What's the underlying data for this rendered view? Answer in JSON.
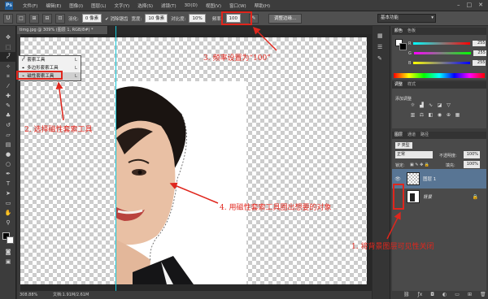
{
  "menu": [
    "文件(F)",
    "编辑(E)",
    "图像(I)",
    "图层(L)",
    "文字(Y)",
    "选择(S)",
    "滤镜(T)",
    "3D(D)",
    "视图(V)",
    "窗口(W)",
    "帮助(H)"
  ],
  "app_logo": "Ps",
  "options": {
    "feather_label": "羽化:",
    "feather_value": "0 像素",
    "antialias_label": "消除锯齿",
    "width_label": "宽度:",
    "width_value": "10 像素",
    "contrast_label": "对比度:",
    "contrast_value": "10%",
    "frequency_label": "频率:",
    "frequency_value": "100",
    "refine_button": "调整边缘...",
    "workspace": "基本功能"
  },
  "document": {
    "tab": "timg.jpg @ 309% (图层 1, RGB/8#) *",
    "zoom": "308.88%",
    "doc_info": "文档:1.91M/2.61M"
  },
  "flyout": {
    "items": [
      {
        "label": "套索工具",
        "key": "L"
      },
      {
        "label": "多边形套索工具",
        "key": "L"
      },
      {
        "label": "磁性套索工具",
        "key": "L"
      }
    ]
  },
  "annotations": {
    "a1": "1. 将背景图层可见性关闭",
    "a2": "2. 选择磁性套索工具",
    "a3": "3. 频率设置为“100”",
    "a4": "4. 用磁性套索工具圈出想要的对象"
  },
  "panels": {
    "color_tabs": [
      "颜色",
      "色板"
    ],
    "color_values": {
      "r": "255",
      "g": "255",
      "b": "255"
    },
    "adjust_tabs": [
      "调整",
      "样式"
    ],
    "adjust_title": "添加调整",
    "layers_tabs": [
      "图层",
      "通道",
      "路径"
    ],
    "kind": "P 类型",
    "blend_mode": "正常",
    "opacity_label": "不透明度:",
    "opacity_value": "100%",
    "lock_label": "锁定:",
    "fill_label": "填充:",
    "fill_value": "100%",
    "layers": [
      {
        "name": "图层 1",
        "visible": true
      },
      {
        "name": "背景",
        "visible": false
      }
    ]
  },
  "colors": {
    "annotation_red": "#e0261d",
    "guide_cyan": "#15c8d8",
    "layer_selected": "#587594"
  }
}
